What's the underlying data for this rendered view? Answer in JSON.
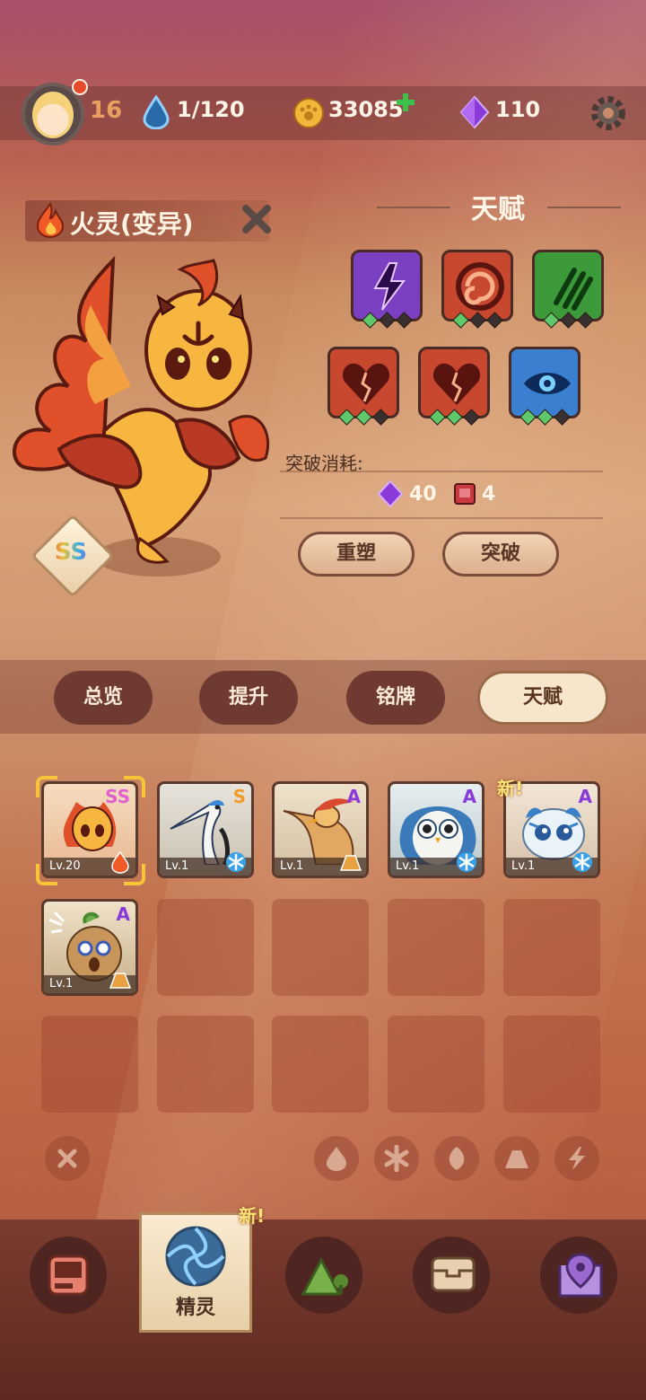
{
  "header": {
    "player_level": "16",
    "stamina": "1/120",
    "coins": "33085",
    "gems": "110",
    "icons": {
      "stamina": "water-drop-icon",
      "coins": "paw-coin-icon",
      "gems": "purple-gem-icon",
      "add": "plus-icon",
      "settings": "gear-icon"
    }
  },
  "spirit": {
    "name": "火灵(变异)",
    "grade": "SS",
    "element_icon": "flame-icon"
  },
  "talent": {
    "title": "天赋",
    "slots": [
      {
        "icon": "lightning-talent-icon",
        "color": "#7b3fc2",
        "gems": [
          true,
          false,
          false
        ]
      },
      {
        "icon": "spiral-talent-icon",
        "color": "#c8472f",
        "gems": [
          true,
          false,
          false
        ]
      },
      {
        "icon": "claw-talent-icon",
        "color": "#3d9a3a",
        "gems": [
          true,
          false,
          false
        ]
      },
      {
        "icon": "broken-heart-talent-icon",
        "color": "#c8472f",
        "gems": [
          true,
          true,
          false
        ]
      },
      {
        "icon": "broken-heart-talent-icon",
        "color": "#c8472f",
        "gems": [
          true,
          true,
          false
        ]
      },
      {
        "icon": "eye-talent-icon",
        "color": "#3a7fd0",
        "gems": [
          true,
          true,
          false
        ]
      }
    ],
    "breakthrough_label": "突破消耗:",
    "cost_gems": "40",
    "cost_books": "4",
    "reforge_label": "重塑",
    "breakthrough_button": "突破"
  },
  "tabs": [
    "总览",
    "提升",
    "铭牌",
    "天赋"
  ],
  "active_tab": "天赋",
  "roster": [
    {
      "rank": "SS",
      "level": "Lv.20",
      "element": "fire",
      "selected": true
    },
    {
      "rank": "S",
      "level": "Lv.1",
      "element": "ice"
    },
    {
      "rank": "A",
      "level": "Lv.1",
      "element": "earth"
    },
    {
      "rank": "A",
      "level": "Lv.1",
      "element": "ice"
    },
    {
      "rank": "A",
      "level": "Lv.1",
      "element": "ice",
      "new": "新!"
    },
    {
      "rank": "A",
      "level": "Lv.1",
      "element": "earth"
    }
  ],
  "filters": [
    "clear-filter-icon",
    "fire-filter-icon",
    "ice-filter-icon",
    "leaf-filter-icon",
    "earth-filter-icon",
    "lightning-filter-icon"
  ],
  "nav": {
    "items": [
      "device-icon",
      "spirit-portal-icon",
      "mountain-icon",
      "chest-icon",
      "map-pin-icon"
    ],
    "active_label": "精灵",
    "new_tag": "新!"
  }
}
